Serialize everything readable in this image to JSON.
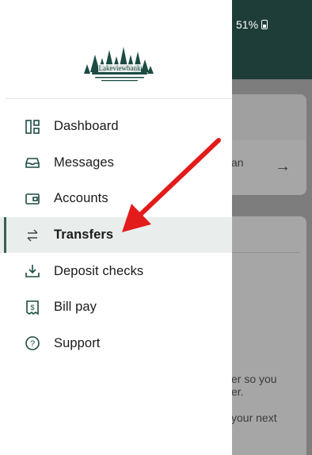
{
  "status_bar": {
    "battery": "51%"
  },
  "brand": {
    "logo_text": "Lakeviewbank"
  },
  "nav": {
    "items": [
      {
        "label": "Dashboard",
        "icon": "dashboard-icon",
        "active": false
      },
      {
        "label": "Messages",
        "icon": "messages-icon",
        "active": false
      },
      {
        "label": "Accounts",
        "icon": "accounts-icon",
        "active": false
      },
      {
        "label": "Transfers",
        "icon": "transfers-icon",
        "active": true
      },
      {
        "label": "Deposit checks",
        "icon": "deposit-icon",
        "active": false
      },
      {
        "label": "Bill pay",
        "icon": "bill-pay-icon",
        "active": false
      },
      {
        "label": "Support",
        "icon": "support-icon",
        "active": false
      }
    ]
  },
  "background": {
    "card1_fragment": "an",
    "card2_fragment_1": "er so you",
    "card2_fragment_2": "er.",
    "card2_fragment_3": "your next"
  },
  "colors": {
    "accent": "#1c4b44",
    "active_bg": "#e9eeed",
    "status_bar": "#1e3c38",
    "arrow": "#e31b1b"
  }
}
